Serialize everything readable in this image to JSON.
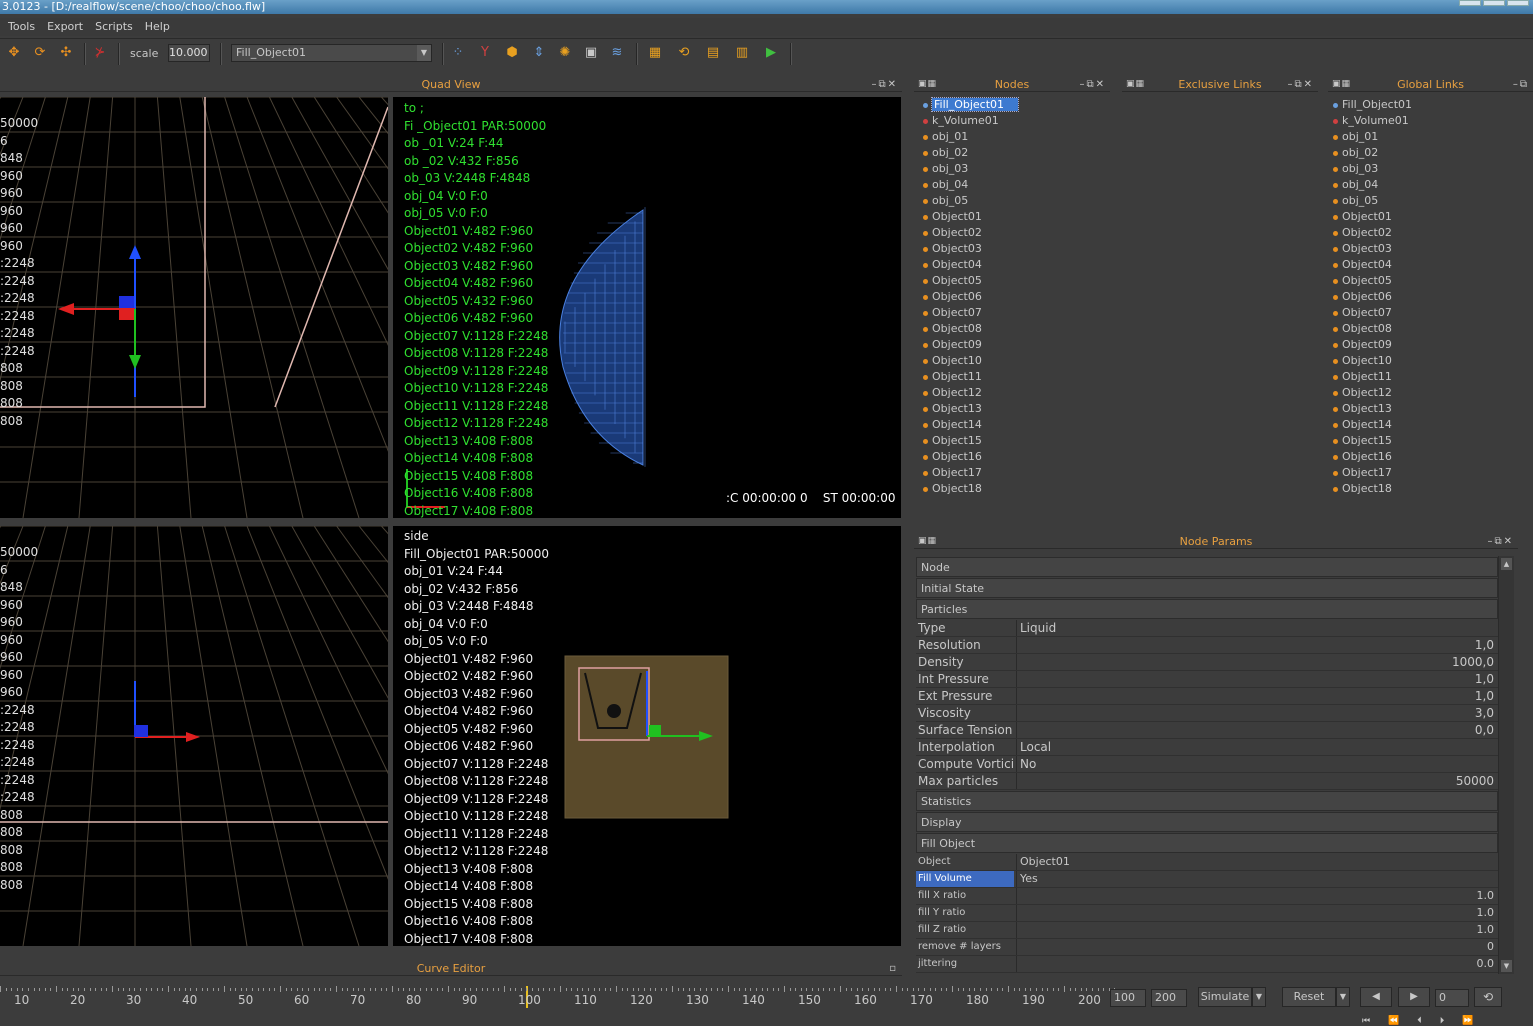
{
  "window": {
    "title": "3.0123 - [D:/realflow/scene/choo/choo/choo.flw]"
  },
  "menu": [
    "Tools",
    "Export",
    "Scripts",
    "Help"
  ],
  "toolbar": {
    "scale_label": "scale",
    "scale_value": "10.000",
    "object_selected": "Fill_Object01"
  },
  "quad_view": {
    "title": "Quad View",
    "left_top_labels": [
      "50000",
      "6",
      "848",
      "960",
      "960",
      "960",
      "960",
      "960",
      ":2248",
      ":2248",
      ":2248",
      ":2248",
      ":2248",
      ":2248",
      "808",
      "808",
      "808",
      "808"
    ],
    "left_bottom_labels": [
      "50000",
      "6",
      "848",
      "960",
      "960",
      "960",
      "960",
      "960",
      "960",
      ":2248",
      ":2248",
      ":2248",
      ":2248",
      ":2248",
      ":2248",
      "808",
      "808",
      "808",
      "808",
      "808"
    ],
    "top_view": {
      "lines": [
        "to ;",
        "Fi _Object01 PAR:50000",
        "ob _01 V:24 F:44",
        "ob _02 V:432 F:856",
        "ob_03 V:2448 F:4848",
        "obj_04 V:0 F:0",
        "obj_05 V:0 F:0",
        "Object01 V:482 F:960",
        "Object02 V:482 F:960",
        "Object03 V:482 F:960",
        "Object04 V:482 F:960",
        "Object05 V:432 F:960",
        "Object06 V:482 F:960",
        "Object07 V:1128 F:2248",
        "Object08 V:1128 F:2248",
        "Object09 V:1128 F:2248",
        "Object10 V:1128 F:2248",
        "Object11 V:1128 F:2248",
        "Object12 V:1128 F:2248",
        "Object13 V:408 F:808",
        "Object14 V:408 F:808",
        "Object15 V:408 F:808",
        "Object16 V:408 F:808",
        "Object17 V:408 F:808"
      ],
      "timecode": ":C 00:00:00 0    ST 00:00:00"
    },
    "side_view": {
      "lines": [
        "side",
        "Fill_Object01 PAR:50000",
        "obj_01 V:24 F:44",
        "obj_02 V:432 F:856",
        "obj_03 V:2448 F:4848",
        "obj_04 V:0 F:0",
        "obj_05 V:0 F:0",
        "Object01 V:482 F:960",
        "Object02 V:482 F:960",
        "Object03 V:482 F:960",
        "Object04 V:482 F:960",
        "Object05 V:482 F:960",
        "Object06 V:482 F:960",
        "Object07 V:1128 F:2248",
        "Object08 V:1128 F:2248",
        "Object09 V:1128 F:2248",
        "Object10 V:1128 F:2248",
        "Object11 V:1128 F:2248",
        "Object12 V:1128 F:2248",
        "Object13 V:408 F:808",
        "Object14 V:408 F:808",
        "Object15 V:408 F:808",
        "Object16 V:408 F:808",
        "Object17 V:408 F:808"
      ]
    }
  },
  "nodes_panel": {
    "title": "Nodes",
    "items": [
      "Fill_Object01",
      "k_Volume01",
      "obj_01",
      "obj_02",
      "obj_03",
      "obj_04",
      "obj_05",
      "Object01",
      "Object02",
      "Object03",
      "Object04",
      "Object05",
      "Object06",
      "Object07",
      "Object08",
      "Object09",
      "Object10",
      "Object11",
      "Object12",
      "Object13",
      "Object14",
      "Object15",
      "Object16",
      "Object17",
      "Object18"
    ]
  },
  "exclusive_links": {
    "title": "Exclusive Links"
  },
  "global_links": {
    "title": "Global Links",
    "items": [
      "Fill_Object01",
      "k_Volume01",
      "obj_01",
      "obj_02",
      "obj_03",
      "obj_04",
      "obj_05",
      "Object01",
      "Object02",
      "Object03",
      "Object04",
      "Object05",
      "Object06",
      "Object07",
      "Object08",
      "Object09",
      "Object10",
      "Object11",
      "Object12",
      "Object13",
      "Object14",
      "Object15",
      "Object16",
      "Object17",
      "Object18"
    ]
  },
  "node_params": {
    "title": "Node Params",
    "sections": {
      "node": "Node",
      "initial_state": "Initial State",
      "particles": "Particles",
      "statistics": "Statistics",
      "display": "Display",
      "fill_object": "Fill Object"
    },
    "particles": [
      {
        "key": "Type",
        "value": "Liquid",
        "num": false
      },
      {
        "key": "Resolution",
        "value": "1,0",
        "num": true
      },
      {
        "key": "Density",
        "value": "1000,0",
        "num": true
      },
      {
        "key": "Int Pressure",
        "value": "1,0",
        "num": true
      },
      {
        "key": "Ext Pressure",
        "value": "1,0",
        "num": true
      },
      {
        "key": "Viscosity",
        "value": "3,0",
        "num": true
      },
      {
        "key": "Surface Tension",
        "value": "0,0",
        "num": true
      },
      {
        "key": "Interpolation",
        "value": "Local",
        "num": false
      },
      {
        "key": "Compute Vorticity",
        "value": "No",
        "num": false
      },
      {
        "key": "Max particles",
        "value": "50000",
        "num": true
      }
    ],
    "fill_object": [
      {
        "key": "Object",
        "value": "Object01",
        "num": false
      },
      {
        "key": "Fill Volume",
        "value": "Yes",
        "num": false
      },
      {
        "key": "fill X ratio",
        "value": "1.0",
        "num": true
      },
      {
        "key": "fill Y ratio",
        "value": "1.0",
        "num": true
      },
      {
        "key": "fill Z ratio",
        "value": "1.0",
        "num": true
      },
      {
        "key": "remove # layers",
        "value": "0",
        "num": true
      },
      {
        "key": "jittering",
        "value": "0.0",
        "num": true
      }
    ]
  },
  "curve_editor": {
    "title": "Curve Editor"
  },
  "timeline": {
    "ticks": [
      "10",
      "20",
      "30",
      "40",
      "50",
      "60",
      "70",
      "80",
      "90",
      "100",
      "110",
      "120",
      "130",
      "140",
      "150",
      "160",
      "170",
      "180",
      "190",
      "200"
    ],
    "current_frame": "100",
    "start_frame": "100",
    "end_frame": "200",
    "simulate_label": "Simulate",
    "reset_label": "Reset",
    "frame_field": "0"
  }
}
